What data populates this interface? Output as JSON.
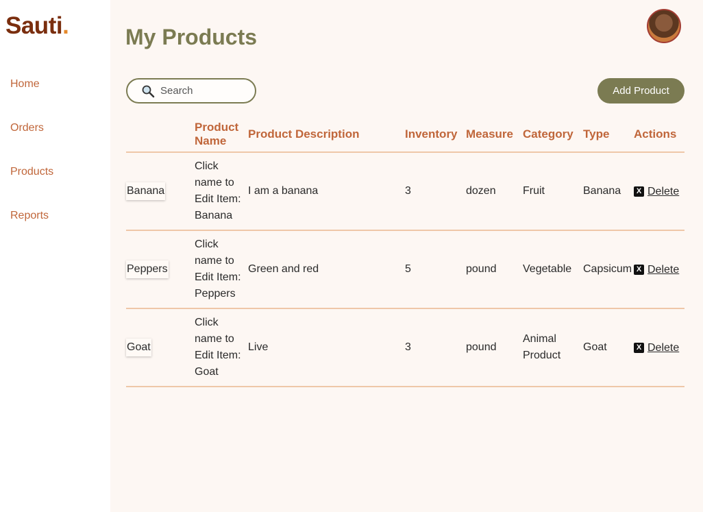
{
  "brand": {
    "name": "Sauti",
    "dot": ".",
    "color": "#7a2e0e",
    "dot_color": "#e58a2c"
  },
  "nav": [
    {
      "label": "Home"
    },
    {
      "label": "Orders"
    },
    {
      "label": "Products"
    },
    {
      "label": "Reports"
    }
  ],
  "page": {
    "title": "My Products"
  },
  "search": {
    "placeholder": "Search",
    "value": ""
  },
  "toolbar": {
    "add_label": "Add Product"
  },
  "table": {
    "headers": [
      "",
      "Product Name",
      "Product Description",
      "Inventory",
      "Measure",
      "Category",
      "Type",
      "Actions"
    ],
    "rows": [
      {
        "image_alt": "Banana",
        "edit_text": "Click name to Edit Item: Banana",
        "description": "I am a banana",
        "inventory": "3",
        "measure": "dozen",
        "category": "Fruit",
        "type": "Banana",
        "action_icon": "X",
        "action_label": "Delete"
      },
      {
        "image_alt": "Peppers",
        "edit_text": "Click name to Edit Item: Peppers",
        "description": "Green and red",
        "inventory": "5",
        "measure": "pound",
        "category": "Vegetable",
        "type": "Capsicum",
        "action_icon": "X",
        "action_label": "Delete"
      },
      {
        "image_alt": "Goat",
        "edit_text": "Click name to Edit Item: Goat",
        "description": "Live",
        "inventory": "3",
        "measure": "pound",
        "category": "Animal Product",
        "type": "Goat",
        "action_icon": "X",
        "action_label": "Delete"
      }
    ]
  },
  "colors": {
    "accent": "#7b7b52",
    "header_text": "#c0663a",
    "divider": "#efc7a8",
    "main_bg": "#fdf7f3"
  }
}
